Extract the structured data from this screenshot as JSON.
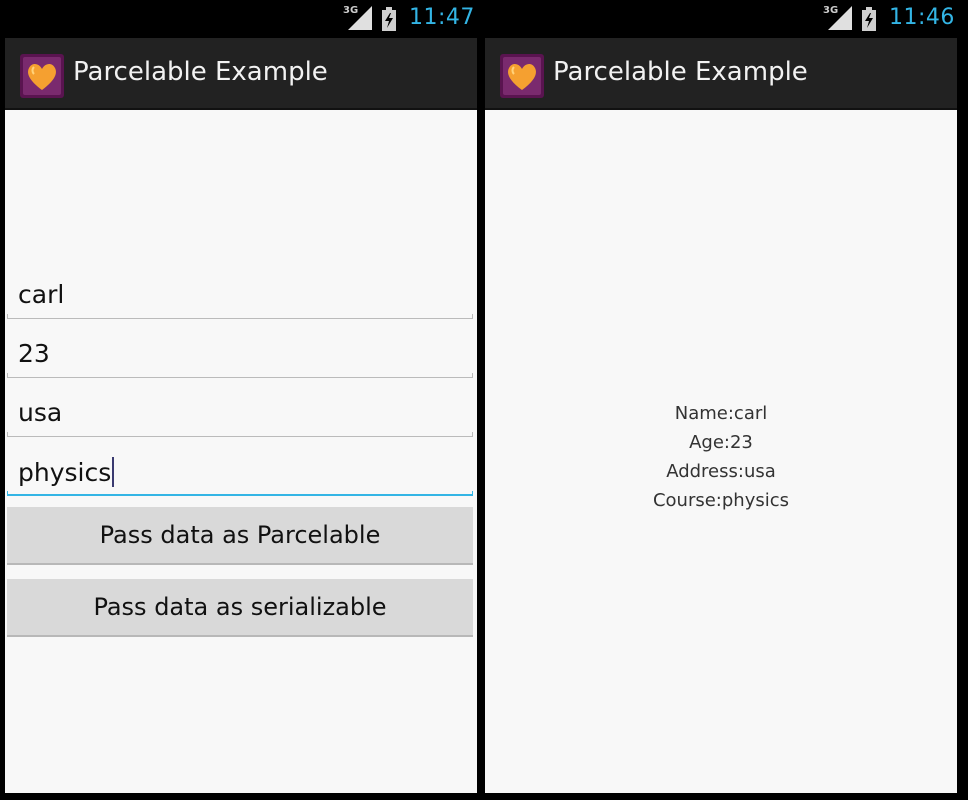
{
  "left_screen": {
    "status_bar": {
      "network": "3G",
      "time": "11:47"
    },
    "action_bar": {
      "title": "Parcelable Example",
      "icon": "heart-app-icon"
    },
    "fields": [
      {
        "value": "carl"
      },
      {
        "value": "23"
      },
      {
        "value": "usa"
      },
      {
        "value": "physics"
      }
    ],
    "buttons": {
      "parcelable_label": "Pass data as Parcelable",
      "serializable_label": "Pass data as serializable"
    }
  },
  "right_screen": {
    "status_bar": {
      "network": "3G",
      "time": "11:46"
    },
    "action_bar": {
      "title": "Parcelable Example",
      "icon": "heart-app-icon"
    },
    "details": {
      "name": "Name:carl",
      "age": "Age:23",
      "address": "Address:usa",
      "course": "Course:physics"
    }
  },
  "colors": {
    "accent": "#33b5e5",
    "action_bar_bg": "#222222",
    "content_bg": "#f8f8f8",
    "button_bg": "#d9d9d9"
  }
}
